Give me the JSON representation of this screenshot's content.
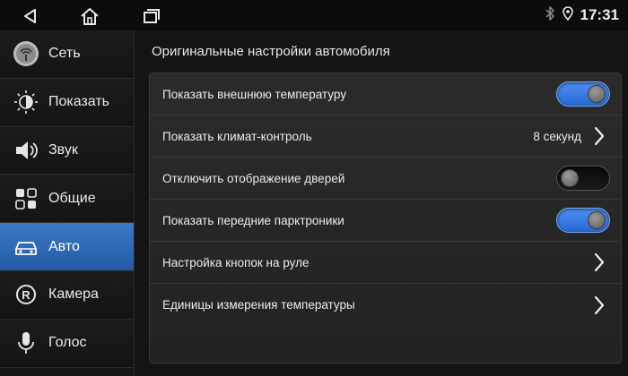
{
  "status_bar": {
    "time": "17:31",
    "icons": [
      "back-icon",
      "home-icon",
      "recent-apps-icon",
      "bluetooth-icon",
      "location-icon"
    ]
  },
  "sidebar": {
    "items": [
      {
        "label": "Сеть",
        "icon": "network-icon",
        "active": false
      },
      {
        "label": "Показать",
        "icon": "brightness-icon",
        "active": false
      },
      {
        "label": "Звук",
        "icon": "speaker-icon",
        "active": false
      },
      {
        "label": "Общие",
        "icon": "grid-icon",
        "active": false
      },
      {
        "label": "Авто",
        "icon": "car-icon",
        "active": true
      },
      {
        "label": "Камера",
        "icon": "camera-r-icon",
        "active": false
      },
      {
        "label": "Голос",
        "icon": "microphone-icon",
        "active": false
      }
    ]
  },
  "main": {
    "title": "Оригинальные настройки автомобиля",
    "rows": [
      {
        "label": "Показать внешнюю температуру",
        "control": "toggle",
        "state": "on"
      },
      {
        "label": "Показать климат-контроль",
        "control": "chevron",
        "value": "8 секунд"
      },
      {
        "label": "Отключить отображение дверей",
        "control": "toggle",
        "state": "off"
      },
      {
        "label": "Показать передние парктроники",
        "control": "toggle",
        "state": "on"
      },
      {
        "label": "Настройка кнопок на руле",
        "control": "chevron"
      },
      {
        "label": "Единицы измерения температуры",
        "control": "chevron"
      }
    ]
  },
  "colors": {
    "accent": "#2f6bc0",
    "toggle_on": "#3a7be0",
    "background": "#141414"
  }
}
